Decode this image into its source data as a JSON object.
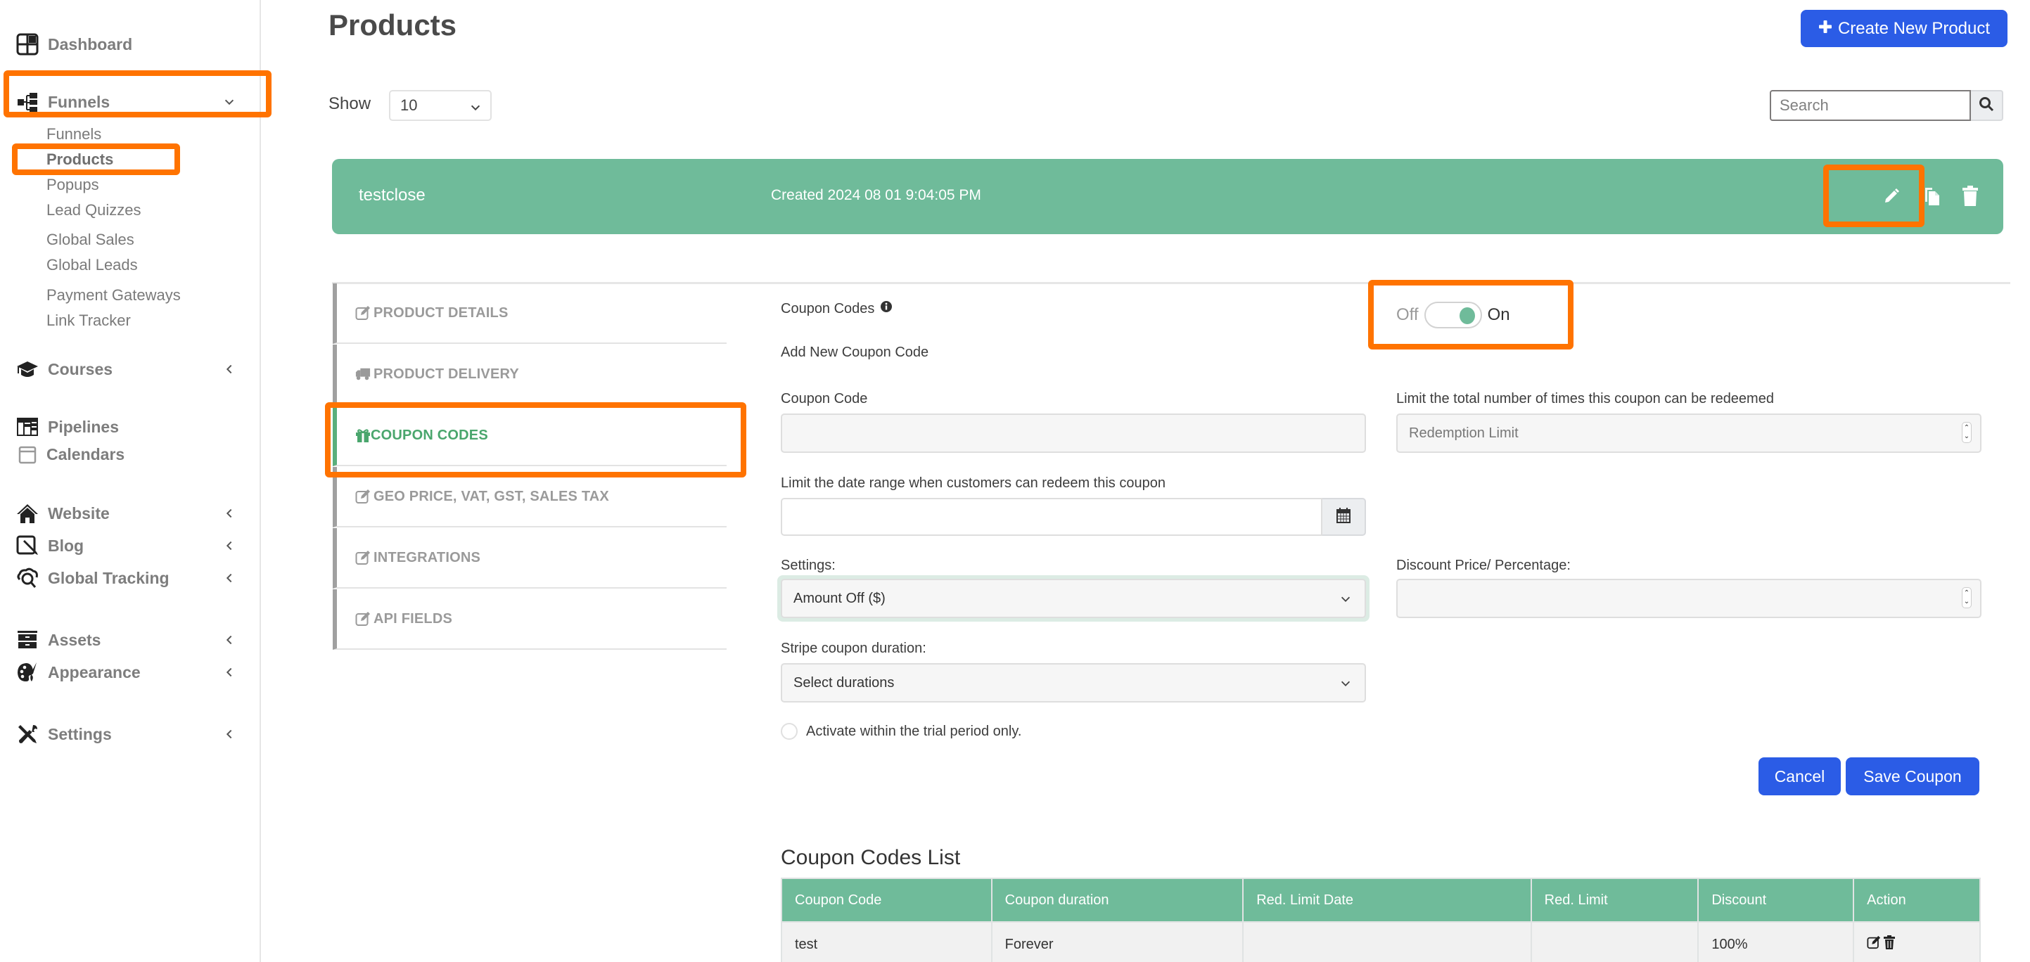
{
  "sidebar": {
    "items": [
      {
        "label": "Dashboard",
        "icon": "dashboard-icon"
      },
      {
        "label": "Funnels",
        "icon": "sitemap-icon",
        "chevron": "down",
        "expanded": true,
        "children": [
          "Funnels",
          "Products",
          "Popups",
          "Lead Quizzes",
          "Global Sales",
          "Global Leads",
          "Payment Gateways",
          "Link Tracker"
        ],
        "active_child": "Products"
      },
      {
        "label": "Courses",
        "icon": "graduation-cap-icon",
        "chevron": "left"
      },
      {
        "label": "Pipelines",
        "icon": "pipeline-icon"
      },
      {
        "label": "Calendars",
        "icon": "calendar-icon"
      },
      {
        "label": "Website",
        "icon": "home-icon",
        "chevron": "left"
      },
      {
        "label": "Blog",
        "icon": "blog-edit-icon",
        "chevron": "left"
      },
      {
        "label": "Global Tracking",
        "icon": "cloud-search-icon",
        "chevron": "left"
      },
      {
        "label": "Assets",
        "icon": "cabinet-icon",
        "chevron": "left"
      },
      {
        "label": "Appearance",
        "icon": "palette-icon",
        "chevron": "left"
      },
      {
        "label": "Settings",
        "icon": "tools-icon",
        "chevron": "left"
      }
    ]
  },
  "header": {
    "title": "Products",
    "create_button": "Create New Product",
    "show_label": "Show",
    "show_value": "10",
    "search_placeholder": "Search"
  },
  "product": {
    "name": "testclose",
    "created": "Created 2024 08 01 9:04:05 PM",
    "actions": [
      "edit-icon",
      "copy-icon",
      "trash-icon"
    ]
  },
  "tabs": [
    {
      "label": "PRODUCT DETAILS",
      "icon": "edit-icon"
    },
    {
      "label": "PRODUCT DELIVERY",
      "icon": "truck-icon"
    },
    {
      "label": "COUPON CODES",
      "icon": "gift-icon",
      "active": true
    },
    {
      "label": "GEO PRICE, VAT, GST, SALES TAX",
      "icon": "edit-icon"
    },
    {
      "label": "INTEGRATIONS",
      "icon": "edit-icon"
    },
    {
      "label": "API FIELDS",
      "icon": "edit-icon"
    }
  ],
  "coupon_form": {
    "section_label": "Coupon Codes",
    "toggle_off": "Off",
    "toggle_on": "On",
    "toggle_state": "on",
    "add_new": "Add New Coupon Code",
    "coupon_code_label": "Coupon Code",
    "coupon_code_value": "",
    "redemption_label": "Limit the total number of times this coupon can be redeemed",
    "redemption_placeholder": "Redemption Limit",
    "date_range_label": "Limit the date range when customers can redeem this coupon",
    "date_range_value": "",
    "settings_label": "Settings:",
    "settings_value": "Amount Off ($)",
    "discount_label": "Discount Price/ Percentage:",
    "discount_value": "",
    "stripe_label": "Stripe coupon duration:",
    "stripe_value": "Select durations",
    "trial_label": "Activate within the trial period only.",
    "trial_checked": false,
    "cancel_button": "Cancel",
    "save_button": "Save Coupon"
  },
  "coupon_list": {
    "title": "Coupon Codes List",
    "columns": [
      "Coupon Code",
      "Coupon duration",
      "Red. Limit Date",
      "Red. Limit",
      "Discount",
      "Action"
    ],
    "rows": [
      {
        "code": "test",
        "duration": "Forever",
        "limit_date": "",
        "limit": "",
        "discount": "100%",
        "actions": [
          "edit-icon",
          "trash-icon"
        ]
      }
    ]
  },
  "colors": {
    "accent_blue": "#2b5ce6",
    "accent_green": "#6fbb9a",
    "active_tab_green": "#4aa66d",
    "highlight_orange": "#ff7300"
  }
}
